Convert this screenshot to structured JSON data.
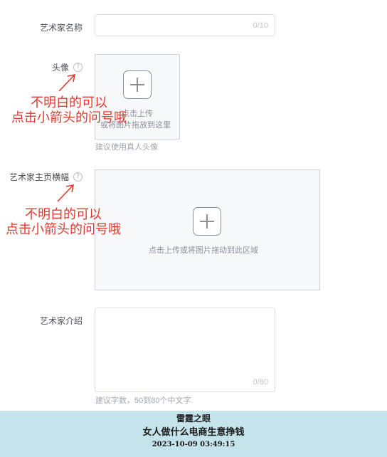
{
  "form": {
    "artist_name_label": "艺术家名称",
    "artist_name_value": "",
    "artist_name_counter": "0/10",
    "avatar_label": "头像",
    "avatar_upload_text_1": "点击上传",
    "avatar_upload_text_2": "或将图片拖放到这里",
    "avatar_hint": "建议使用真人头像",
    "banner_label": "艺术家主页横幅",
    "banner_upload_text": "点击上传或将图片拖动到此区域",
    "intro_label": "艺术家介绍",
    "intro_value": "",
    "intro_counter": "0/80",
    "intro_hint": "建议字数，50到80个中文字",
    "help_glyph": "?"
  },
  "annotations": {
    "line1": "不明白的可以",
    "line2": "点击小箭头的问号哦"
  },
  "footer": {
    "line1": "雷霆之眼",
    "line2": "女人做什么电商生意挣钱",
    "line3": "2023-10-09 03:49:15"
  },
  "colors": {
    "annotation": "#e03a30",
    "footer_bg": "#c4e3ea"
  },
  "icons": [
    "question-circle-icon",
    "plus-icon",
    "arrow-icon"
  ]
}
